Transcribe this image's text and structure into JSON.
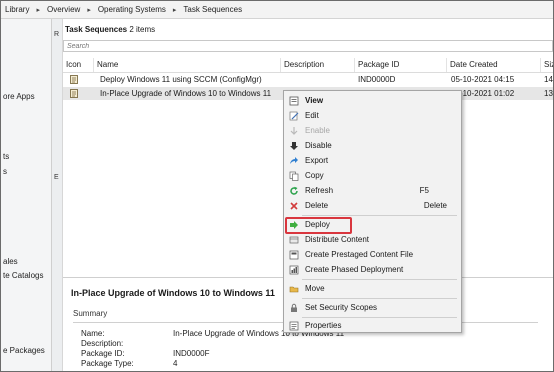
{
  "breadcrumb": [
    "Library",
    "Overview",
    "Operating Systems",
    "Task Sequences"
  ],
  "left_nav": {
    "items": [
      "ore Apps",
      "ts",
      "s",
      "ales",
      "te Catalogs",
      "e Packages"
    ]
  },
  "splitter_labels": [
    "R",
    "E"
  ],
  "panel": {
    "title": "Task Sequences",
    "count": "2 items",
    "search_placeholder": "Search"
  },
  "columns": [
    "Icon",
    "Name",
    "Description",
    "Package ID",
    "Date Created",
    "Siz"
  ],
  "rows": [
    {
      "name": "Deploy Windows 11 using SCCM (ConfigMgr)",
      "description": "",
      "package_id": "IND0000D",
      "date_created": "05-10-2021 04:15",
      "size": "14"
    },
    {
      "name": "In-Place Upgrade of Windows 10 to Windows 11",
      "description": "",
      "package_id": "IND0000F",
      "date_created": "05-10-2021 01:02",
      "size": "13"
    }
  ],
  "details": {
    "title": "In-Place Upgrade of Windows 10 to Windows 11",
    "summary_label": "Summary",
    "fields": [
      {
        "k": "Name:",
        "v": "In-Place Upgrade of Windows 10 to Windows 11"
      },
      {
        "k": "Description:",
        "v": ""
      },
      {
        "k": "Package ID:",
        "v": "IND0000F"
      },
      {
        "k": "Package Type:",
        "v": "4"
      }
    ]
  },
  "context_menu": {
    "groups": [
      [
        {
          "label": "View",
          "icon": "view-icon",
          "bold": true
        },
        {
          "label": "Edit",
          "icon": "edit-icon"
        },
        {
          "label": "Enable",
          "icon": "enable-icon",
          "disabled": true
        },
        {
          "label": "Disable",
          "icon": "disable-arrow-icon"
        },
        {
          "label": "Export",
          "icon": "export-icon"
        },
        {
          "label": "Copy",
          "icon": "copy-icon"
        },
        {
          "label": "Refresh",
          "icon": "refresh-icon",
          "shortcut": "F5"
        },
        {
          "label": "Delete",
          "icon": "delete-icon",
          "shortcut": "Delete"
        }
      ],
      [
        {
          "label": "Deploy",
          "icon": "deploy-arrow-icon",
          "highlighted": true
        },
        {
          "label": "Distribute Content",
          "icon": "distribute-icon"
        },
        {
          "label": "Create Prestaged Content File",
          "icon": "prestaged-icon"
        },
        {
          "label": "Create Phased Deployment",
          "icon": "phased-deployment-icon"
        }
      ],
      [
        {
          "label": "Move",
          "icon": "move-icon"
        }
      ],
      [
        {
          "label": "Set Security Scopes",
          "icon": "security-scopes-icon"
        }
      ],
      [
        {
          "label": "Properties",
          "icon": "properties-icon"
        }
      ]
    ]
  },
  "colors": {
    "highlight_box": "#d9363e",
    "selected_row": "#e6e6e6",
    "menu_bg": "#f2f2f2"
  }
}
